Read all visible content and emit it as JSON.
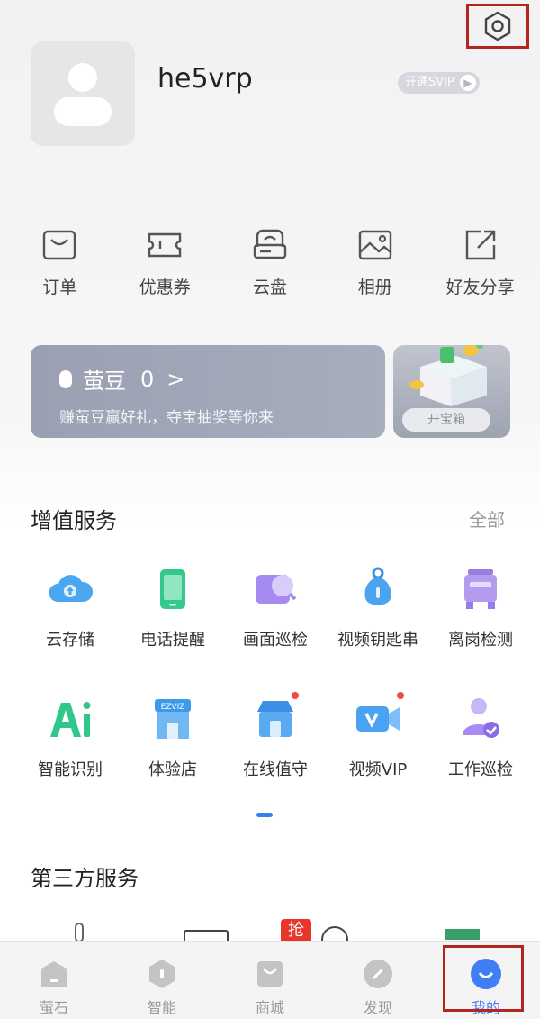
{
  "profile": {
    "username": "he5vrp",
    "svip_label": "开通SVIP"
  },
  "quick_actions": [
    {
      "label": "订单",
      "icon": "bag-icon"
    },
    {
      "label": "优惠券",
      "icon": "ticket-icon"
    },
    {
      "label": "云盘",
      "icon": "cloud-drive-icon"
    },
    {
      "label": "相册",
      "icon": "photo-icon"
    },
    {
      "label": "好友分享",
      "icon": "share-icon"
    }
  ],
  "bean_card": {
    "title": "萤豆",
    "count": "0",
    "chevron": ">",
    "subtitle": "赚萤豆赢好礼，夺宝抽奖等你来",
    "treasure_label": "开宝箱"
  },
  "value_services": {
    "title": "增值服务",
    "see_all": "全部",
    "row1": [
      {
        "label": "云存储",
        "icon": "cloud-storage-icon"
      },
      {
        "label": "电话提醒",
        "icon": "phone-icon"
      },
      {
        "label": "画面巡检",
        "icon": "image-inspect-icon"
      },
      {
        "label": "视频钥匙串",
        "icon": "key-icon"
      },
      {
        "label": "离岗检测",
        "icon": "post-detect-icon"
      }
    ],
    "row2": [
      {
        "label": "智能识别",
        "icon": "ai-icon"
      },
      {
        "label": "体验店",
        "icon": "store-icon"
      },
      {
        "label": "在线值守",
        "icon": "online-watch-icon"
      },
      {
        "label": "视频VIP",
        "icon": "video-vip-icon"
      },
      {
        "label": "工作巡检",
        "icon": "work-inspect-icon"
      }
    ],
    "logo_text": "EZVIZ"
  },
  "third_party": {
    "title": "第三方服务",
    "badge": "抢"
  },
  "tabbar": [
    {
      "label": "萤石",
      "icon": "home-icon"
    },
    {
      "label": "智能",
      "icon": "smart-icon"
    },
    {
      "label": "商城",
      "icon": "mall-icon"
    },
    {
      "label": "发现",
      "icon": "discover-icon"
    },
    {
      "label": "我的",
      "icon": "me-icon"
    }
  ],
  "colors": {
    "accent": "#3f7ef5",
    "highlight_border": "#b3261e"
  }
}
